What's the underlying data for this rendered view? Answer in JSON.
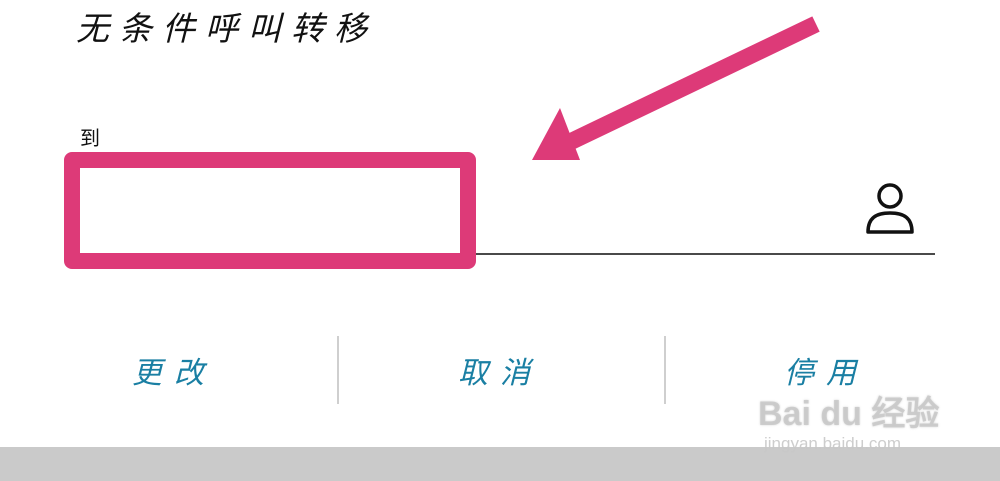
{
  "screen": {
    "title": "无条件呼叫转移"
  },
  "form": {
    "number_label": "到",
    "number_value": ""
  },
  "actions": {
    "change_label": "更改",
    "cancel_label": "取消",
    "disable_label": "停用"
  },
  "icons": {
    "contact": "person-icon"
  },
  "annotation": {
    "highlight_color": "#dd3a78",
    "arrow_color": "#dd3a78"
  },
  "watermark": {
    "logo": "Bai du 经验",
    "url": "jingyan.baidu.com"
  },
  "colors": {
    "action_text": "#1a7fa3",
    "bottom_bar": "#cacaca"
  }
}
